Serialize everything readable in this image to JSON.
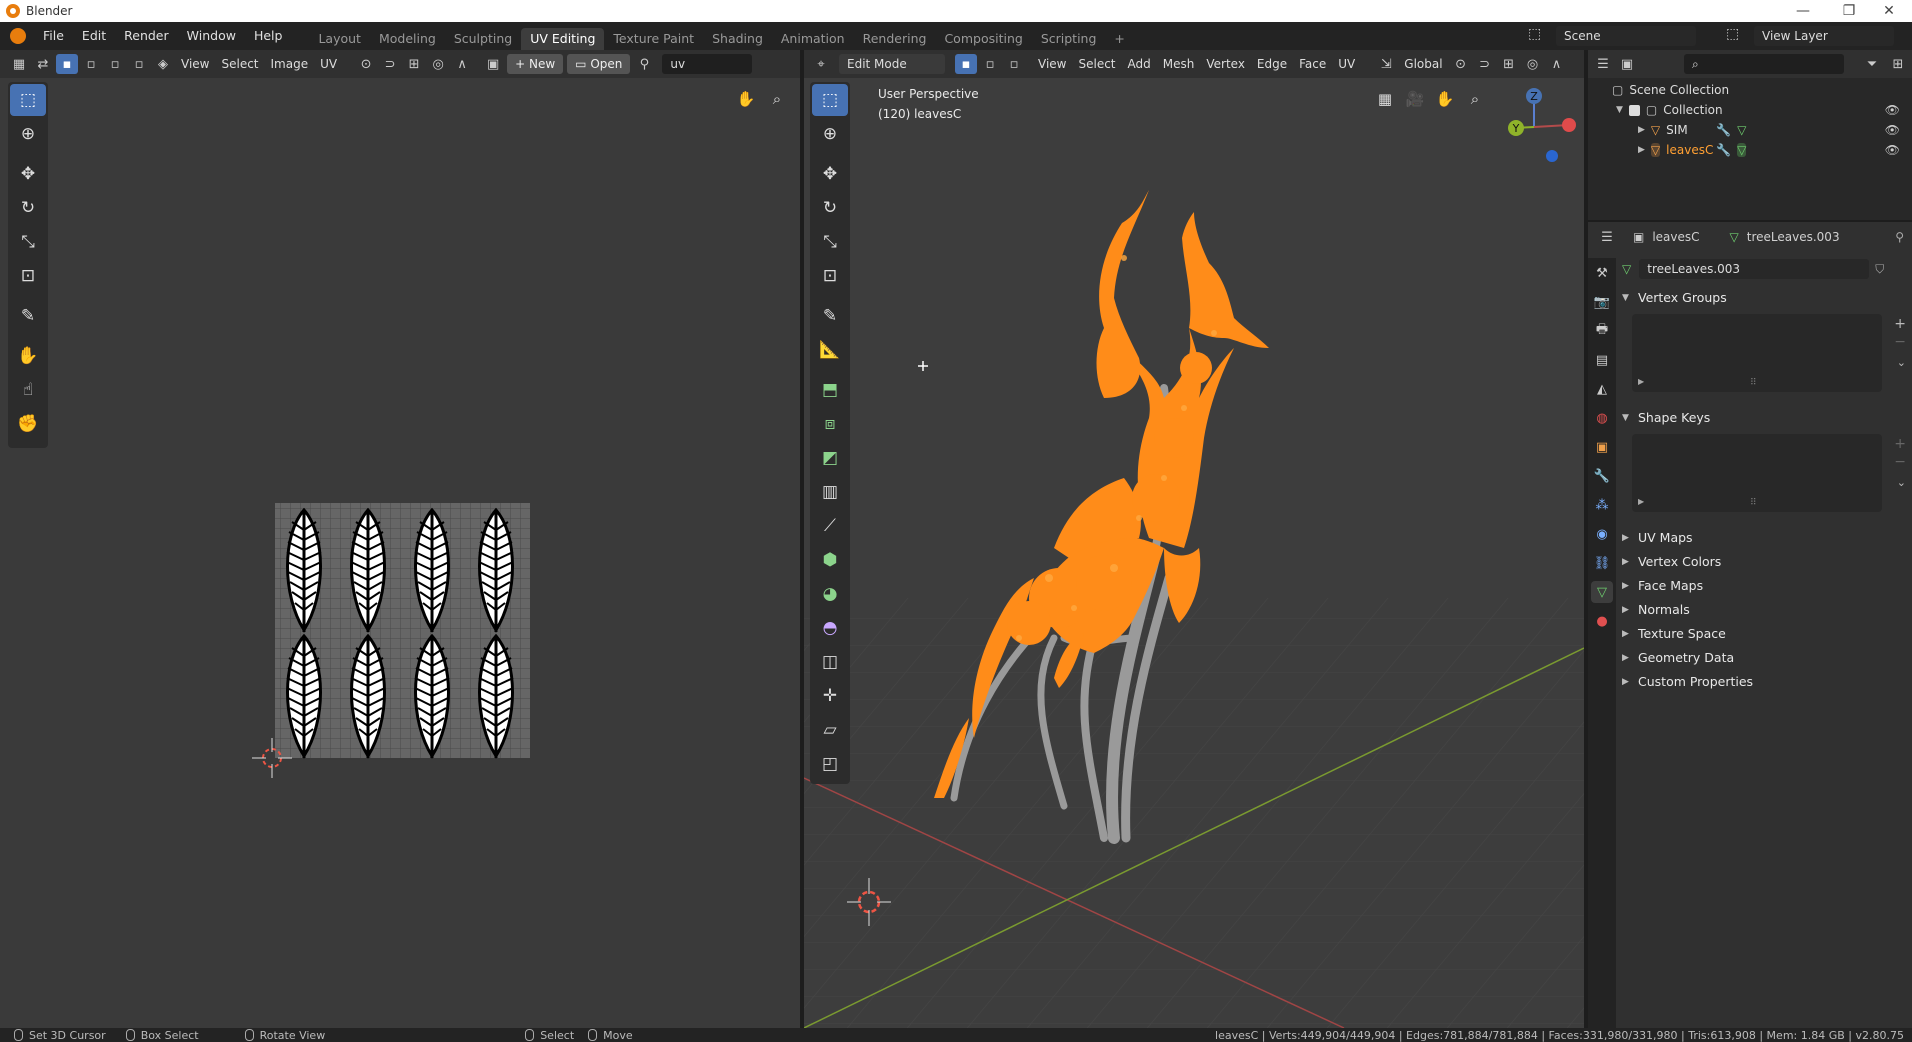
{
  "window": {
    "title": "Blender",
    "minimize": "—",
    "restore": "❐",
    "close": "✕"
  },
  "topbar": {
    "menus": [
      "File",
      "Edit",
      "Render",
      "Window",
      "Help"
    ],
    "workspaces": [
      "Layout",
      "Modeling",
      "Sculpting",
      "UV Editing",
      "Texture Paint",
      "Shading",
      "Animation",
      "Rendering",
      "Compositing",
      "Scripting"
    ],
    "active_workspace": "UV Editing",
    "add_tab": "+",
    "scene_label": "Scene",
    "view_layer_label": "View Layer"
  },
  "uv_editor": {
    "menus": [
      "View",
      "Select",
      "Image",
      "UV"
    ],
    "new_label": "New",
    "open_label": "Open",
    "uv_map_name": "uv"
  },
  "viewport": {
    "mode": "Edit Mode",
    "menus": [
      "View",
      "Select",
      "Add",
      "Mesh",
      "Vertex",
      "Edge",
      "Face",
      "UV"
    ],
    "orientation": "Global",
    "overlay_line1": "User Perspective",
    "overlay_line2": "(120) leavesC",
    "gizmo": {
      "z": "Z",
      "y": "Y"
    }
  },
  "outliner": {
    "scene_collection": "Scene Collection",
    "collection": "Collection",
    "objects": [
      "SIM",
      "leavesC"
    ],
    "search_placeholder": ""
  },
  "properties": {
    "object_name": "leavesC",
    "mesh_name": "treeLeaves.003",
    "data_field": "treeLeaves.003",
    "panels_open": [
      "Vertex Groups",
      "Shape Keys"
    ],
    "panels_closed": [
      "UV Maps",
      "Vertex Colors",
      "Face Maps",
      "Normals",
      "Texture Space",
      "Geometry Data",
      "Custom Properties"
    ]
  },
  "statusbar": {
    "items": [
      "Set 3D Cursor",
      "Box Select",
      "Rotate View",
      "Select",
      "Move"
    ],
    "stats": "leavesC | Verts:449,904/449,904 | Edges:781,884/781,884 | Faces:331,980/331,980 | Tris:613,908 | Mem: 1.84 GB | v2.80.75"
  },
  "colors": {
    "accent": "#4772b3",
    "selection": "#ff8c19",
    "active_object": "#ffa033",
    "mesh_grey": "#9a9a9a",
    "x_axis": "#b34b4b",
    "y_axis": "#8fb32a"
  }
}
